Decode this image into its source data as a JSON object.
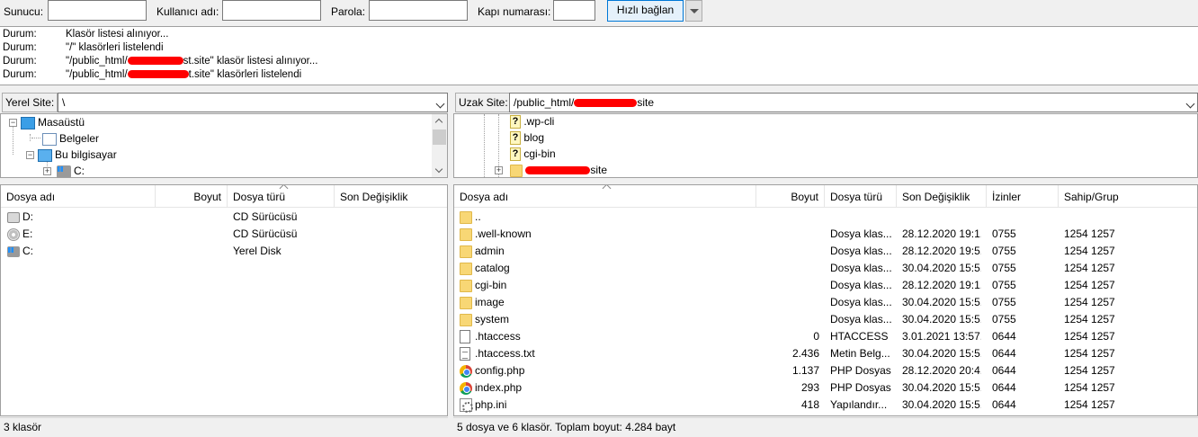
{
  "quickconnect": {
    "host_label": "Sunucu:",
    "host_value": "",
    "user_label": "Kullanıcı adı:",
    "user_value": "",
    "pass_label": "Parola:",
    "pass_value": "",
    "port_label": "Kapı numarası:",
    "port_value": "",
    "connect_button": "Hızlı bağlan"
  },
  "log": [
    {
      "type": "Durum:",
      "pre": "Klasör listesi alınıyor...",
      "post": ""
    },
    {
      "type": "Durum:",
      "pre": "\"/\" klasörleri listelendi",
      "post": ""
    },
    {
      "type": "Durum:",
      "pre": "\"/public_html/",
      "post": "st.site\" klasör listesi alınıyor..."
    },
    {
      "type": "Durum:",
      "pre": "\"/public_html/",
      "post": "t.site\" klasörleri listelendi"
    }
  ],
  "local": {
    "site_label": "Yerel Site:",
    "path": "\\",
    "tree": [
      "Masaüstü",
      "Belgeler",
      "Bu bilgisayar",
      "C:"
    ],
    "columns": [
      "Dosya adı",
      "Boyut",
      "Dosya türü",
      "Son Değişiklik"
    ],
    "rows": [
      {
        "name": "D:",
        "type": "CD Sürücüsü",
        "icon": "cd-drive-icon"
      },
      {
        "name": "E:",
        "type": "CD Sürücüsü",
        "icon": "cd-disc-icon"
      },
      {
        "name": "C:",
        "type": "Yerel Disk",
        "icon": "local-disk-icon"
      }
    ],
    "status": "3 klasör"
  },
  "remote": {
    "site_label": "Uzak Site:",
    "path_pre": "/public_html/",
    "path_post": "site",
    "tree": [
      ".wp-cli",
      "blog",
      "cgi-bin"
    ],
    "tree_last_suffix": "site",
    "columns": [
      "Dosya adı",
      "Boyut",
      "Dosya türü",
      "Son Değişiklik",
      "İzinler",
      "Sahip/Grup"
    ],
    "rows": [
      {
        "name": "..",
        "size": "",
        "type": "",
        "date": "",
        "perm": "",
        "owner": "",
        "icon": "folder"
      },
      {
        "name": ".well-known",
        "size": "",
        "type": "Dosya klas...",
        "date": "28.12.2020 19:1...",
        "perm": "0755",
        "owner": "1254 1257",
        "icon": "folder"
      },
      {
        "name": "admin",
        "size": "",
        "type": "Dosya klas...",
        "date": "28.12.2020 19:5...",
        "perm": "0755",
        "owner": "1254 1257",
        "icon": "folder"
      },
      {
        "name": "catalog",
        "size": "",
        "type": "Dosya klas...",
        "date": "30.04.2020 15:5...",
        "perm": "0755",
        "owner": "1254 1257",
        "icon": "folder"
      },
      {
        "name": "cgi-bin",
        "size": "",
        "type": "Dosya klas...",
        "date": "28.12.2020 19:1...",
        "perm": "0755",
        "owner": "1254 1257",
        "icon": "folder"
      },
      {
        "name": "image",
        "size": "",
        "type": "Dosya klas...",
        "date": "30.04.2020 15:5...",
        "perm": "0755",
        "owner": "1254 1257",
        "icon": "folder"
      },
      {
        "name": "system",
        "size": "",
        "type": "Dosya klas...",
        "date": "30.04.2020 15:5...",
        "perm": "0755",
        "owner": "1254 1257",
        "icon": "folder"
      },
      {
        "name": ".htaccess",
        "size": "0",
        "type": "HTACCESS ...",
        "date": "3.01.2021 13:57...",
        "perm": "0644",
        "owner": "1254 1257",
        "icon": "file"
      },
      {
        "name": ".htaccess.txt",
        "size": "2.436",
        "type": "Metin Belg...",
        "date": "30.04.2020 15:5...",
        "perm": "0644",
        "owner": "1254 1257",
        "icon": "text"
      },
      {
        "name": "config.php",
        "size": "1.137",
        "type": "PHP Dosyası",
        "date": "28.12.2020 20:4...",
        "perm": "0644",
        "owner": "1254 1257",
        "icon": "chrome"
      },
      {
        "name": "index.php",
        "size": "293",
        "type": "PHP Dosyası",
        "date": "30.04.2020 15:5...",
        "perm": "0644",
        "owner": "1254 1257",
        "icon": "chrome"
      },
      {
        "name": "php.ini",
        "size": "418",
        "type": "Yapılandır...",
        "date": "30.04.2020 15:5...",
        "perm": "0644",
        "owner": "1254 1257",
        "icon": "gear"
      }
    ],
    "status": "5 dosya ve 6 klasör. Toplam boyut: 4.284 bayt"
  }
}
